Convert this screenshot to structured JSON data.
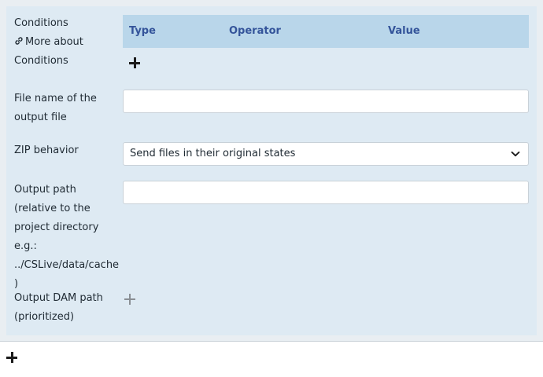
{
  "conditions": {
    "label": "Conditions",
    "more_link": "More about Conditions",
    "columns": [
      "Type",
      "Operator",
      "Value"
    ]
  },
  "output_file": {
    "label": "File name of the output file",
    "value": ""
  },
  "zip": {
    "label": "ZIP behavior",
    "selected": "Send files in their original states"
  },
  "output_path": {
    "label": "Output path (relative to the project directory e.g.: ../CSLive/data/cache )",
    "value": ""
  },
  "dam_path": {
    "label": "Output DAM path (prioritized)"
  }
}
